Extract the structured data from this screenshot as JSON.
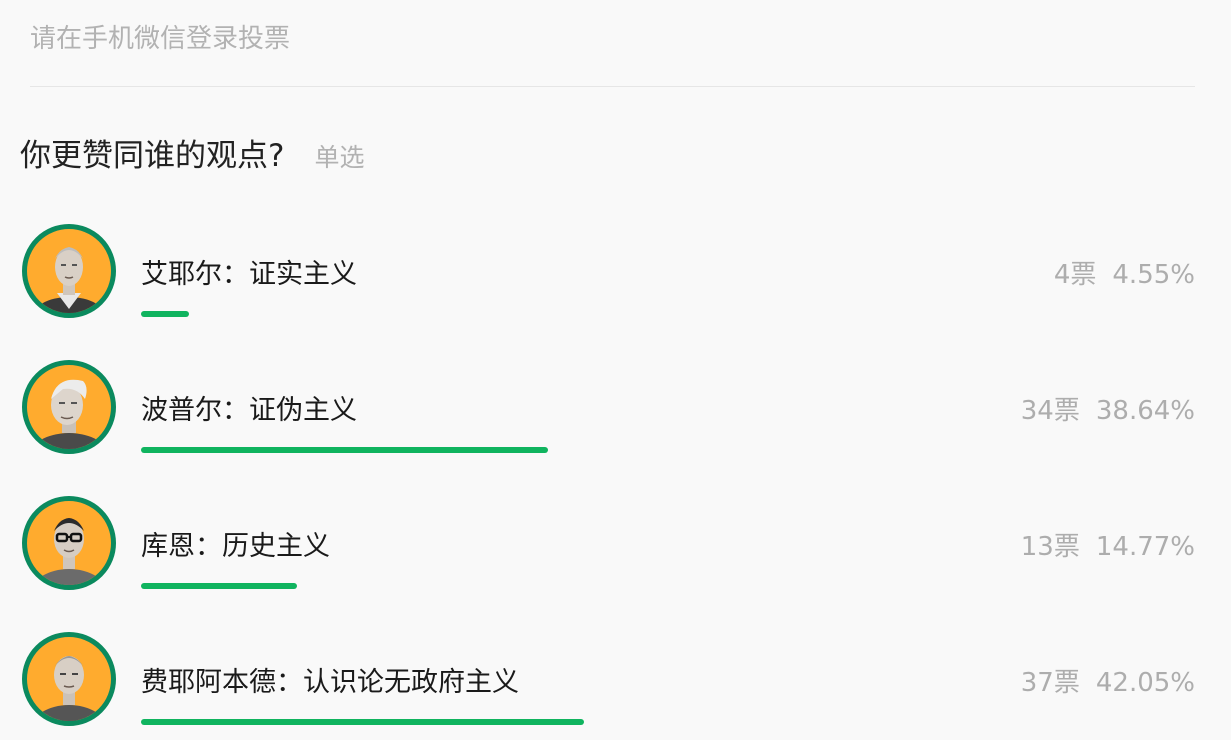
{
  "header": {
    "login_hint": "请在手机微信登录投票"
  },
  "question": {
    "title": "你更赞同谁的观点?",
    "type": "单选"
  },
  "colors": {
    "accent_bar": "#10b45f",
    "avatar_ring": "#0b8a5e",
    "avatar_bg": "#ffab2e"
  },
  "options": [
    {
      "label": "艾耶尔：证实主义",
      "votes": "4票",
      "percent": "4.55%",
      "share": 0.0455,
      "avatar_icon": "portrait-ayer"
    },
    {
      "label": "波普尔：证伪主义",
      "votes": "34票",
      "percent": "38.64%",
      "share": 0.3864,
      "avatar_icon": "portrait-popper"
    },
    {
      "label": "库恩：历史主义",
      "votes": "13票",
      "percent": "14.77%",
      "share": 0.1477,
      "avatar_icon": "portrait-kuhn"
    },
    {
      "label": "费耶阿本德：认识论无政府主义",
      "votes": "37票",
      "percent": "42.05%",
      "share": 0.4205,
      "avatar_icon": "portrait-feyerabend"
    }
  ]
}
